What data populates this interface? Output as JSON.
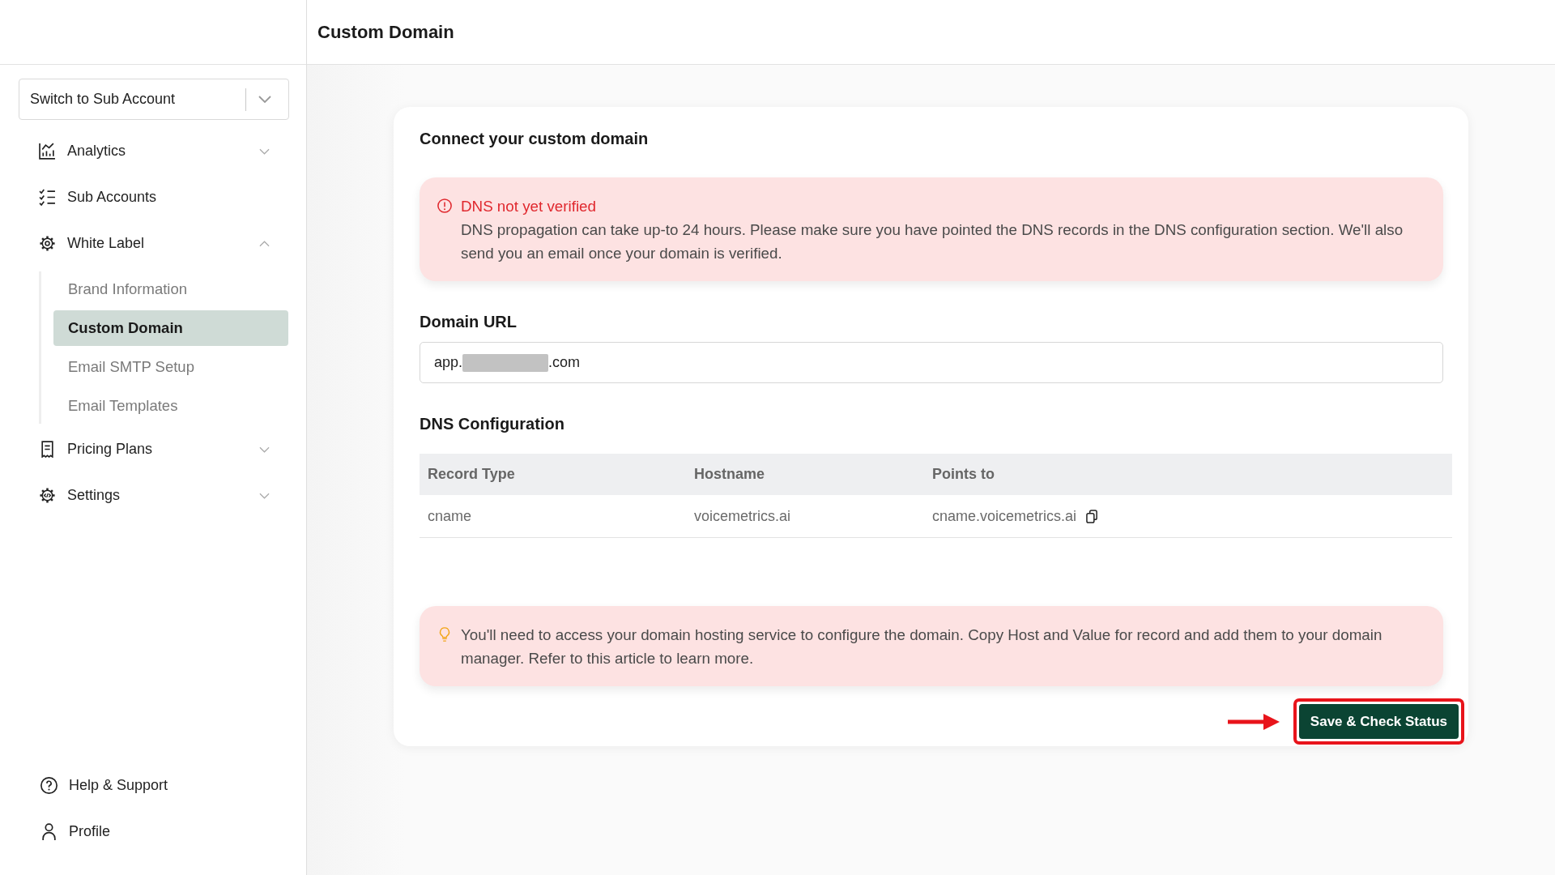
{
  "header": {
    "title": "Custom Domain"
  },
  "sidebar": {
    "account_switcher": {
      "placeholder": "Switch to Sub Account"
    },
    "items": [
      {
        "label": "Analytics",
        "kind": "group",
        "expanded": false
      },
      {
        "label": "Sub Accounts",
        "kind": "link"
      },
      {
        "label": "White Label",
        "kind": "group",
        "expanded": true,
        "children": [
          {
            "label": "Brand Information",
            "selected": false
          },
          {
            "label": "Custom Domain",
            "selected": true
          },
          {
            "label": "Email SMTP Setup",
            "selected": false
          },
          {
            "label": "Email Templates",
            "selected": false
          }
        ]
      },
      {
        "label": "Pricing Plans",
        "kind": "group",
        "expanded": false
      },
      {
        "label": "Settings",
        "kind": "group",
        "expanded": false
      }
    ],
    "footer_items": [
      {
        "label": "Help & Support"
      },
      {
        "label": "Profile"
      }
    ]
  },
  "card": {
    "title": "Connect your custom domain",
    "status_alert": {
      "kind": "error",
      "title": "DNS not yet verified",
      "text": "DNS propagation can take up-to 24 hours. Please make sure you have pointed the DNS records in the DNS configuration section. We'll also send you an email once your domain is verified."
    },
    "domain_url": {
      "label": "Domain URL",
      "value_start": "app.",
      "redacted": true,
      "value_end": ".com"
    },
    "dns_configuration": {
      "title": "DNS Configuration",
      "columns": [
        "Record Type",
        "Hostname",
        "Points to"
      ],
      "rows": [
        {
          "cells": [
            "cname",
            "voicemetrics.ai",
            "cname.voicemetrics.ai"
          ]
        }
      ]
    },
    "tip_alert": {
      "kind": "tip",
      "text": "You'll need to access your domain hosting service to configure the domain. Copy Host and Value for record and add them to your domain manager. Refer to this article to learn more."
    },
    "save_button": {
      "label": "Save & Check Status",
      "highlighted": true,
      "pointed_at": true
    }
  }
}
